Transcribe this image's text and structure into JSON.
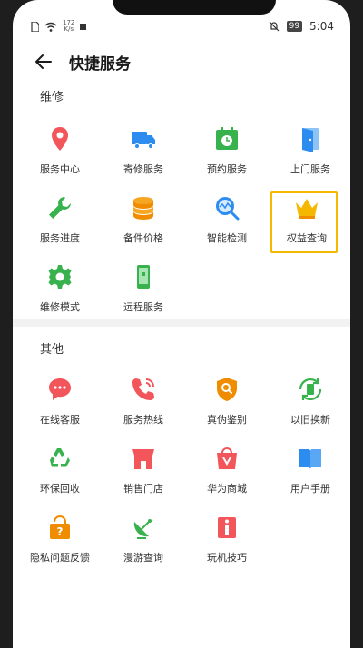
{
  "status_bar": {
    "net_speed": "172",
    "net_speed_unit": "K/s",
    "battery": "99",
    "time": "5:04"
  },
  "header": {
    "title": "快捷服务"
  },
  "sections": [
    {
      "title": "维修",
      "items": [
        {
          "label": "服务中心",
          "icon": "location-pin-icon",
          "color": "#f2555a"
        },
        {
          "label": "寄修服务",
          "icon": "truck-icon",
          "color": "#2d8cf0"
        },
        {
          "label": "预约服务",
          "icon": "calendar-clock-icon",
          "color": "#37b24d"
        },
        {
          "label": "上门服务",
          "icon": "door-icon",
          "color": "#2d8cf0"
        },
        {
          "label": "服务进度",
          "icon": "wrench-icon",
          "color": "#37b24d"
        },
        {
          "label": "备件价格",
          "icon": "coins-icon",
          "color": "#f08c00"
        },
        {
          "label": "智能检测",
          "icon": "diagnostic-icon",
          "color": "#2d8cf0"
        },
        {
          "label": "权益查询",
          "icon": "crown-icon",
          "color": "#f5b800"
        },
        {
          "label": "维修模式",
          "icon": "gear-icon",
          "color": "#37b24d"
        },
        {
          "label": "远程服务",
          "icon": "phone-remote-icon",
          "color": "#37b24d"
        }
      ]
    },
    {
      "title": "其他",
      "items": [
        {
          "label": "在线客服",
          "icon": "chat-bubble-icon",
          "color": "#f2555a"
        },
        {
          "label": "服务热线",
          "icon": "phone-call-icon",
          "color": "#f2555a"
        },
        {
          "label": "真伪鉴别",
          "icon": "shield-search-icon",
          "color": "#f08c00"
        },
        {
          "label": "以旧换新",
          "icon": "trade-in-icon",
          "color": "#37b24d"
        },
        {
          "label": "环保回收",
          "icon": "recycle-icon",
          "color": "#37b24d"
        },
        {
          "label": "销售门店",
          "icon": "store-icon",
          "color": "#f2555a"
        },
        {
          "label": "华为商城",
          "icon": "shopping-bag-icon",
          "color": "#f2555a"
        },
        {
          "label": "用户手册",
          "icon": "book-icon",
          "color": "#2d8cf0"
        },
        {
          "label": "隐私问题反馈",
          "icon": "privacy-help-icon",
          "color": "#f08c00"
        },
        {
          "label": "漫游查询",
          "icon": "satellite-dish-icon",
          "color": "#37b24d"
        },
        {
          "label": "玩机技巧",
          "icon": "tips-icon",
          "color": "#f2555a"
        }
      ]
    }
  ]
}
